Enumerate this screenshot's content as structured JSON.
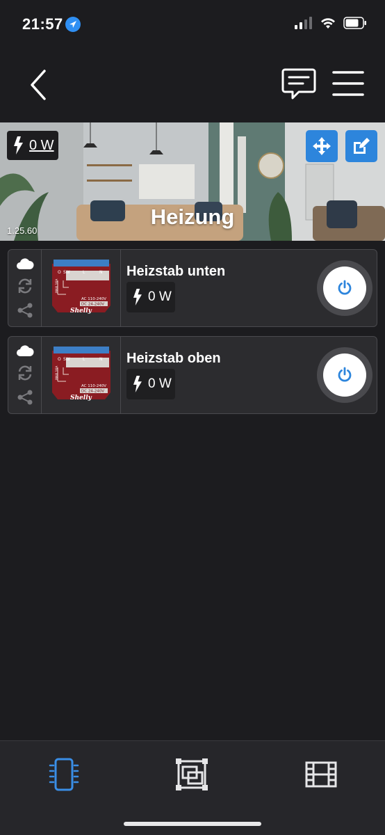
{
  "status_bar": {
    "time": "21:57"
  },
  "header": {
    "icons": [
      "back-icon",
      "message-icon",
      "menu-icon"
    ]
  },
  "room": {
    "title": "Heizung",
    "power": "0 W",
    "version": "1.25.60",
    "icons": [
      "move-icon",
      "edit-icon",
      "bolt-icon"
    ]
  },
  "devices": [
    {
      "name": "Heizstab unten",
      "power": "0 W"
    },
    {
      "name": "Heizstab oben",
      "power": "0 W"
    }
  ],
  "device_module_labels": {
    "ac": "AC 110-240V",
    "dc": "DC 24-240V",
    "brand": "Shelly",
    "o": "O",
    "sw": "SW",
    "l": "L",
    "n": "N",
    "max": "MAX 16A"
  },
  "bottom_nav": {
    "items": [
      "devices-icon",
      "rooms-icon",
      "scenes-icon"
    ],
    "active_color": "#3a8ee6",
    "inactive_color": "#e6e6e8"
  },
  "colors": {
    "accent": "#2d85dc",
    "background": "#1c1c1f",
    "card": "#2c2c2f"
  }
}
